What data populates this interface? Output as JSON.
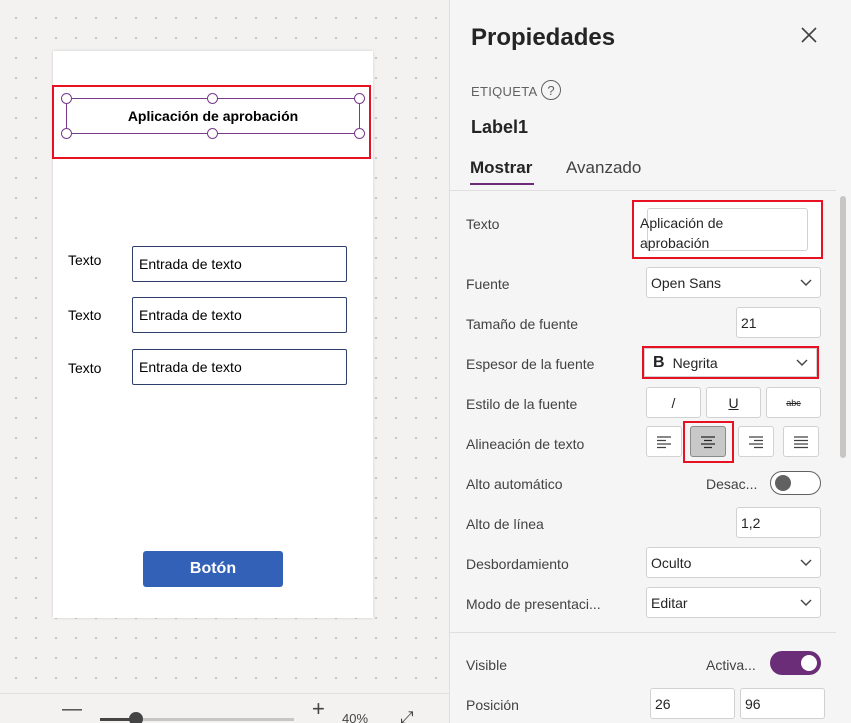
{
  "canvas": {
    "app_title": "Aplicación de aprobación",
    "form_rows": [
      {
        "label": "Texto",
        "placeholder": "Entrada de texto"
      },
      {
        "label": "Texto",
        "placeholder": "Entrada de texto"
      },
      {
        "label": "Texto",
        "placeholder": "Entrada de texto"
      }
    ],
    "button_label": "Botón",
    "zoom": {
      "minus": "—",
      "plus": "+",
      "value": "40%",
      "level_percent": 40
    }
  },
  "panel": {
    "title": "Propiedades",
    "control_type": "ETIQUETA",
    "control_name": "Label1",
    "tabs": {
      "show": "Mostrar",
      "advanced": "Avanzado"
    },
    "properties": {
      "text": {
        "label": "Texto",
        "value": "Aplicación de aprobación"
      },
      "font": {
        "label": "Fuente",
        "value": "Open Sans"
      },
      "font_size": {
        "label": "Tamaño de fuente",
        "value": "21"
      },
      "font_weight": {
        "label": "Espesor de la fuente",
        "value": "Negrita",
        "icon": "B"
      },
      "font_style": {
        "label": "Estilo de la fuente",
        "italic": "/",
        "underline": "U",
        "strike": "abc"
      },
      "text_align": {
        "label": "Alineación de texto",
        "selected": "center"
      },
      "auto_height": {
        "label": "Alto automático",
        "state": "Desac...",
        "on": false
      },
      "line_height": {
        "label": "Alto de línea",
        "value": "1,2"
      },
      "overflow": {
        "label": "Desbordamiento",
        "value": "Oculto"
      },
      "display_mode": {
        "label": "Modo de presentaci...",
        "value": "Editar"
      },
      "visible": {
        "label": "Visible",
        "state": "Activa...",
        "on": true
      },
      "position": {
        "label": "Posición",
        "x": "26",
        "y": "96"
      }
    }
  },
  "colors": {
    "accent": "#6b2c78",
    "highlight": "#e81123",
    "button": "#3461b8",
    "selection": "#7a3b8c"
  },
  "icons": {
    "close": "close-icon",
    "help": "help-icon",
    "chevron": "chevron-down-icon",
    "fit": "fit-to-screen-icon"
  }
}
